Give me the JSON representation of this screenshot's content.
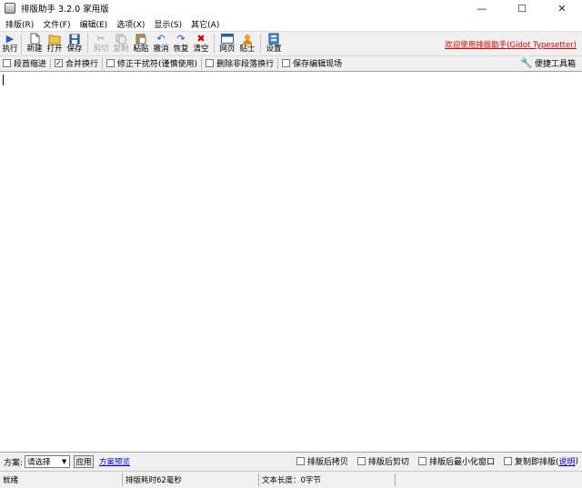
{
  "window": {
    "title": "排版助手 3.2.0 家用版",
    "controls": {
      "minimize": "—",
      "maximize": "☐",
      "close": "✕"
    }
  },
  "menu": [
    "排版(R)",
    "文件(F)",
    "编辑(E)",
    "选项(X)",
    "显示(S)",
    "其它(A)"
  ],
  "toolbar": {
    "execute": "执行",
    "new": "新建",
    "open": "打开",
    "save": "保存",
    "cut": "剪切",
    "copy": "复制",
    "paste": "粘贴",
    "undo": "撤消",
    "redo": "恢复",
    "clear": "清空",
    "web": "网页",
    "tips": "贴士",
    "settings": "设置",
    "welcome": "欢迎使用排版助手(Gidot Typesetter)"
  },
  "options": {
    "indent": {
      "label": "段首缩进",
      "checked": false
    },
    "merge": {
      "label": "合并换行",
      "checked": true
    },
    "fix_wrap": {
      "label": "修正干扰符(谨慎使用)",
      "checked": false
    },
    "remove_nonpara": {
      "label": "删除非段落换行",
      "checked": false
    },
    "save_state": {
      "label": "保存编辑现场",
      "checked": false
    },
    "toolbox": "便捷工具箱"
  },
  "bottom": {
    "scheme_label": "方案:",
    "scheme_value": "请选择",
    "apply": "应用",
    "scheme_link": "方案预览",
    "after_copy": "排版后拷贝",
    "after_cut": "排版后剪切",
    "after_minimize": "排版后最小化窗口",
    "copy_then": "复制即排版(",
    "help": "说明",
    "close_paren": ")"
  },
  "status": {
    "ready": "就绪",
    "elapsed": "排版耗时62毫秒",
    "length": "文本长度：0字节"
  },
  "colors": {
    "accent_red": "#e00000",
    "link_blue": "#0000ee"
  }
}
